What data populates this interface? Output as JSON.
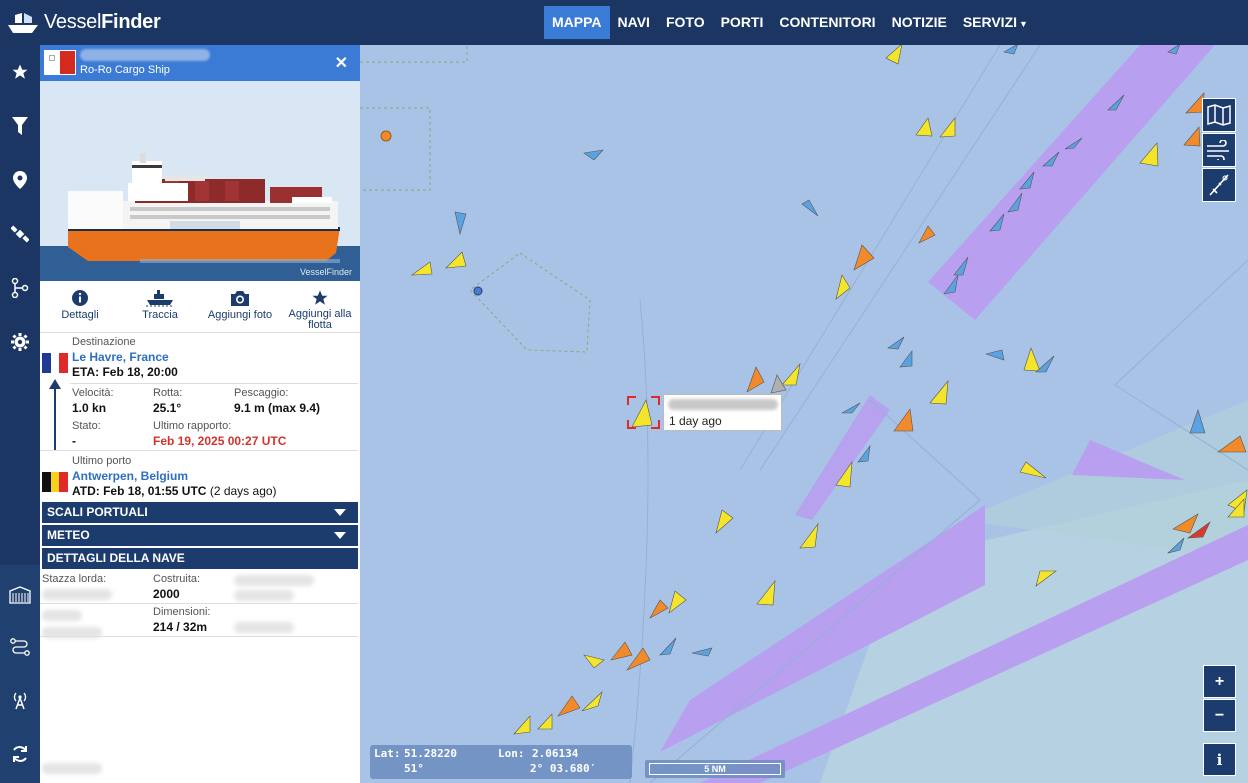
{
  "brand": {
    "part1": "Vessel",
    "part2": "Finder"
  },
  "nav": [
    "MAPPA",
    "NAVI",
    "FOTO",
    "PORTI",
    "CONTENITORI",
    "NOTIZIE",
    "SERVIZI"
  ],
  "nav_active": "MAPPA",
  "rail_icons": [
    "star-icon",
    "filter-icon",
    "location-pin-icon",
    "satellite-icon",
    "route-icon",
    "gear-icon",
    "container-icon",
    "route-plan-icon",
    "antenna-icon",
    "refresh-icon"
  ],
  "vessel": {
    "type": "Ro-Ro Cargo Ship",
    "photo_credit": "VesselFinder"
  },
  "actions": [
    {
      "label": "Dettagli",
      "icon": "info-icon"
    },
    {
      "label": "Traccia",
      "icon": "ship-track-icon"
    },
    {
      "label": "Aggiungi foto",
      "icon": "camera-icon"
    },
    {
      "label": "Aggiungi alla flotta",
      "icon": "star-icon"
    }
  ],
  "voyage": {
    "destination_label": "Destinazione",
    "destination": "Le Havre, France",
    "eta": "ETA: Feb 18, 20:00",
    "speed_label": "Velocità:",
    "speed": "1.0 kn",
    "course_label": "Rotta:",
    "course": "25.1°",
    "draught_label": "Pescaggio:",
    "draught": "9.1 m (max 9.4)",
    "status_label": "Stato:",
    "status": "-",
    "last_report_label": "Ultimo rapporto:",
    "last_report": "Feb 19, 2025 00:27 UTC",
    "last_port_label": "Ultimo porto",
    "last_port": "Antwerpen, Belgium",
    "atd": "ATD: Feb 18, 01:55 UTC",
    "atd_ago": "(2 days ago)"
  },
  "sections": [
    "SCALI PORTUALI",
    "METEO",
    "DETTAGLI DELLA NAVE"
  ],
  "details": {
    "gross_label": "Stazza lorda:",
    "built_label": "Costruita:",
    "built": "2000",
    "dimensions_label": "Dimensioni:",
    "dimensions": "214 / 32m"
  },
  "tooltip": {
    "ago": "1 day ago"
  },
  "coords": {
    "lat_label": "Lat:",
    "lat": "51.28220",
    "lat_dms": "51°",
    "lon_label": "Lon:",
    "lon": "2.06134",
    "lon_dms": "2° 03.680′"
  },
  "scale": "5 NM",
  "zoom": {
    "in": "+",
    "out": "−"
  },
  "info_button": "i",
  "colors": {
    "topbar": "#1b3663",
    "active_tab": "#3a7bd5",
    "panel_head": "#3b7bd6",
    "sea": "#a9c3e6",
    "lane": "#b59ef0",
    "cargo": "#f5e52a",
    "tanker": "#f08a2a",
    "passenger": "#5aa3e0"
  }
}
